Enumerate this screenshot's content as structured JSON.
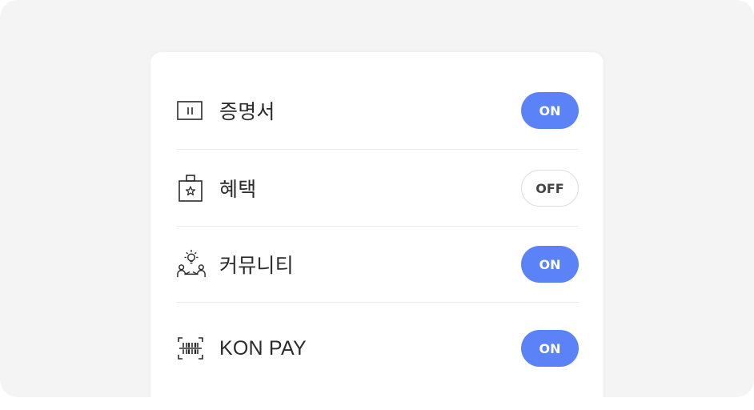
{
  "settings": {
    "items": [
      {
        "label": "증명서",
        "icon": "certificate-icon",
        "toggle": "ON",
        "state": "on"
      },
      {
        "label": "혜택",
        "icon": "shopping-bag-star-icon",
        "toggle": "OFF",
        "state": "off"
      },
      {
        "label": "커뮤니티",
        "icon": "community-people-idea-icon",
        "toggle": "ON",
        "state": "on"
      },
      {
        "label": "KON PAY",
        "icon": "barcode-scan-icon",
        "toggle": "ON",
        "state": "on"
      }
    ]
  },
  "colors": {
    "toggle_on": "#5b82f6",
    "toggle_off_border": "#dedede",
    "background": "#f4f4f4",
    "card": "#ffffff"
  }
}
